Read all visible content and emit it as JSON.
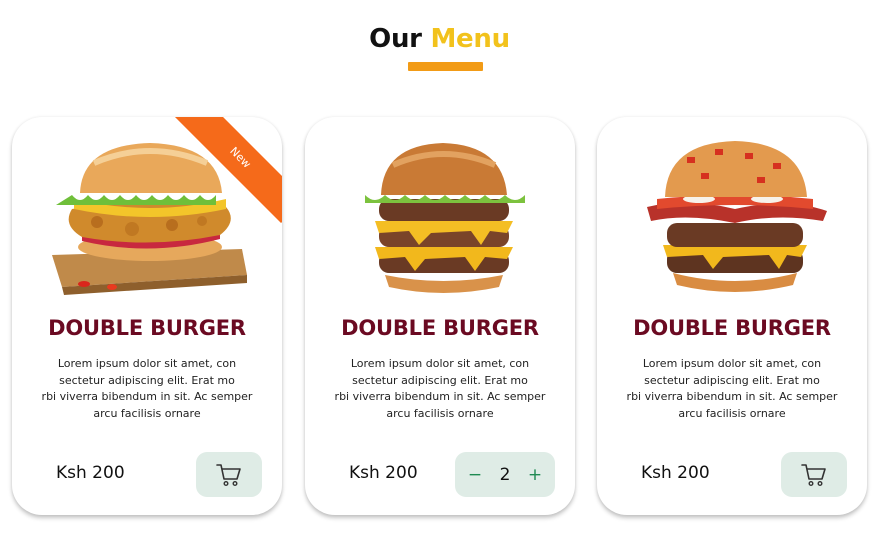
{
  "header": {
    "title_part1": "Our",
    "title_part2": "Menu"
  },
  "cards": [
    {
      "ribbon": "New",
      "image": "crispy-chicken-burger-on-board",
      "title": "DOUBLE BURGER",
      "desc_lines": [
        "Lorem ipsum dolor sit amet, con",
        "sectetur adipiscing elit. Erat mo",
        "rbi viverra bibendum in sit. Ac semper",
        "arcu facilisis ornare"
      ],
      "price": "Ksh 200",
      "action": {
        "type": "cart",
        "icon": "cart-icon"
      }
    },
    {
      "image": "double-cheeseburger",
      "title": "DOUBLE BURGER",
      "desc_lines": [
        "Lorem ipsum dolor sit amet, con",
        "sectetur adipiscing elit. Erat mo",
        "rbi viverra bibendum in sit. Ac semper",
        "arcu facilisis ornare"
      ],
      "price": "Ksh 200",
      "action": {
        "type": "stepper",
        "minus": "−",
        "qty": "2",
        "plus": "+"
      }
    },
    {
      "image": "bacon-cheeseburger",
      "title": "DOUBLE BURGER",
      "desc_lines": [
        "Lorem ipsum dolor sit amet, con",
        "sectetur adipiscing elit. Erat mo",
        "rbi viverra bibendum in sit. Ac semper",
        "arcu facilisis ornare"
      ],
      "price": "Ksh 200",
      "action": {
        "type": "cart",
        "icon": "cart-icon"
      }
    }
  ],
  "colors": {
    "accent_yellow": "#f2c21c",
    "underline": "#f29b16",
    "title_maroon": "#6b0a22",
    "ribbon": "#f56a1a",
    "button_bg": "#dfece6",
    "stepper_green": "#1f8a52"
  }
}
